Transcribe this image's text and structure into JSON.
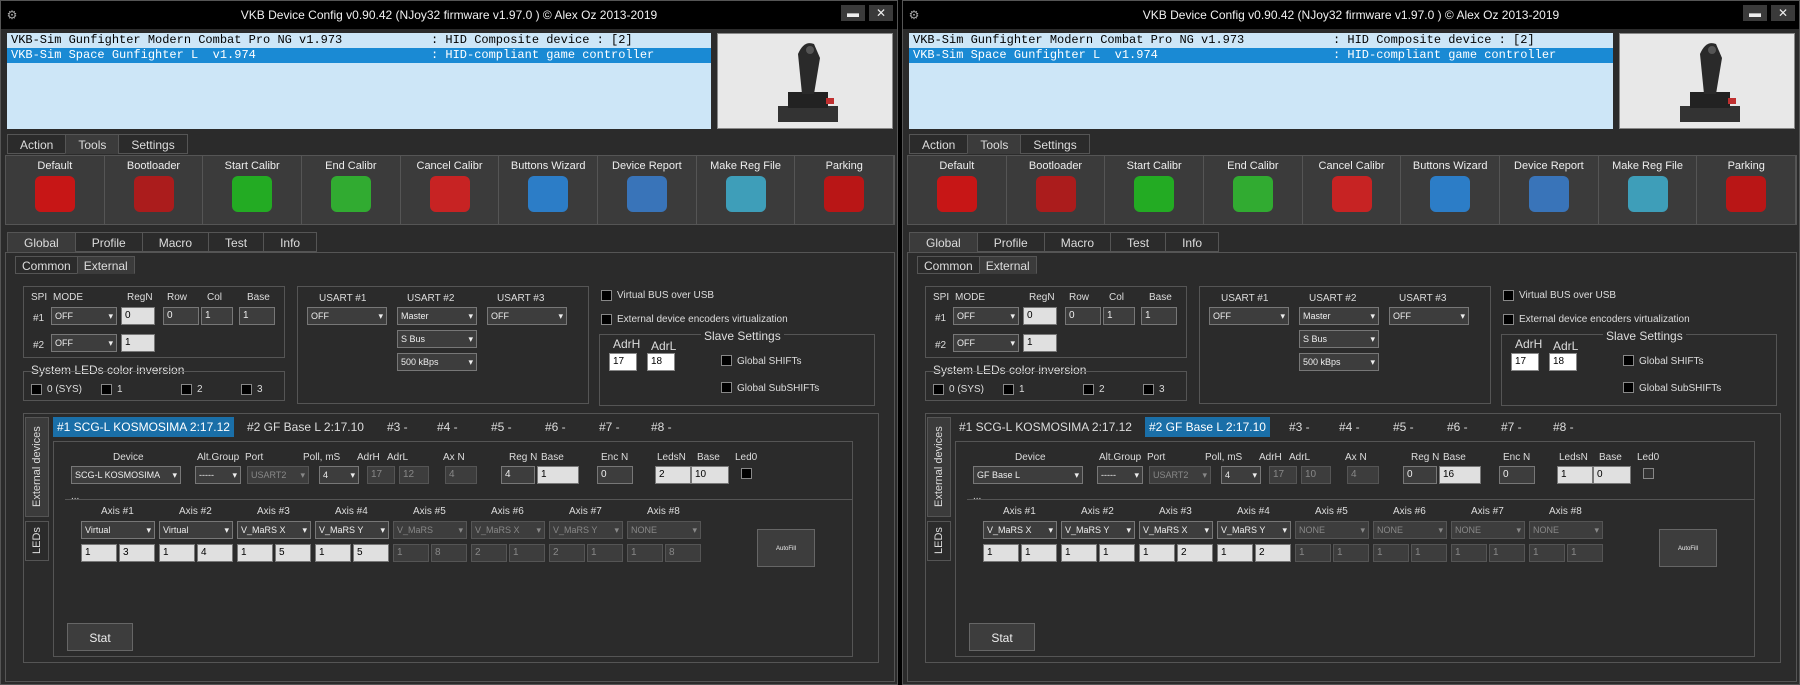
{
  "title": "VKB Device Config v0.90.42 (NJoy32 firmware v1.97.0  ) © Alex Oz 2013-2019",
  "window_buttons": {
    "minimize": "▬",
    "close": "✕"
  },
  "devices": [
    {
      "name": "VKB-Sim Gunfighter Modern Combat Pro NG v1.973",
      "desc": ": HID Composite device : [2]"
    },
    {
      "name": "VKB-Sim Space Gunfighter L  v1.974",
      "desc": ": HID-compliant game controller"
    }
  ],
  "main_tabs": [
    "Action",
    "Tools",
    "Settings"
  ],
  "tools": [
    {
      "label": "Default",
      "icon": "red-button-icon",
      "color": "#e01010"
    },
    {
      "label": "Bootloader",
      "icon": "recycle-icon",
      "color": "#c01818"
    },
    {
      "label": "Start Calibr",
      "icon": "caliper-play-icon",
      "color": "#20c020"
    },
    {
      "label": "End Calibr",
      "icon": "caliper-check-icon",
      "color": "#30c030"
    },
    {
      "label": "Cancel Calibr",
      "icon": "caliper-cross-icon",
      "color": "#e02020"
    },
    {
      "label": "Buttons Wizard",
      "icon": "wizard-icon",
      "color": "#2a8ae0"
    },
    {
      "label": "Device Report",
      "icon": "report-icon",
      "color": "#3a7fd0"
    },
    {
      "label": "Make Reg File",
      "icon": "cube-icon",
      "color": "#40b0d0"
    },
    {
      "label": "Parking",
      "icon": "parking-icon",
      "color": "#d01010"
    }
  ],
  "sub_tabs": [
    "Global",
    "Profile",
    "Macro",
    "Test",
    "Info"
  ],
  "inner_tabs": [
    "Common",
    "External"
  ],
  "spi": {
    "headers": [
      "SPI",
      "MODE",
      "RegN",
      "Row",
      "Col",
      "Base"
    ],
    "rows": [
      {
        "label": "#1",
        "mode": "OFF",
        "regn": "0",
        "row": "0",
        "col": "1",
        "base": "1"
      },
      {
        "label": "#2",
        "mode": "OFF",
        "regn": "1"
      }
    ]
  },
  "sys_leds": {
    "title": "System LEDs color inversion",
    "items": [
      "0 (SYS)",
      "1",
      "2",
      "3"
    ]
  },
  "usart": {
    "headers": [
      "USART #1",
      "USART #2",
      "USART #3"
    ],
    "u1": "OFF",
    "u2": "Master",
    "u2b": "S Bus",
    "u2c": "500 kBps",
    "u3": "OFF"
  },
  "virt": {
    "bus": "Virtual BUS over USB",
    "enc": "External device encoders virtualization"
  },
  "slave": {
    "title": "Slave Settings",
    "adrh_label": "AdrH",
    "adrl_label": "AdrL",
    "adrh": "17",
    "adrl": "18",
    "gshift": "Global SHIFTs",
    "gsubshift": "Global SubSHIFTs"
  },
  "ext_tabs": [
    "#1 SCG-L KOSMOSIMA 2:17.12",
    "#2 GF Base L 2:17.10",
    "#3 -",
    "#4 -",
    "#5 -",
    "#6 -",
    "#7 -",
    "#8 -"
  ],
  "side_tabs": [
    "External devices",
    "LEDs"
  ],
  "dev_headers": [
    "Device",
    "Alt.Group",
    "Port",
    "Poll, mS",
    "AdrH",
    "AdrL",
    "Ax N",
    "Reg N",
    "Base",
    "Enc N",
    "LedsN",
    "Base",
    "Led0"
  ],
  "ellipsis": "...",
  "axis_headers": [
    "Axis #1",
    "Axis #2",
    "Axis #3",
    "Axis #4",
    "Axis #5",
    "Axis #6",
    "Axis #7",
    "Axis #8"
  ],
  "autofill": "AutoFill",
  "stat": "Stat",
  "windows": [
    {
      "sel_device": 1,
      "ext_active": 0,
      "dev": {
        "device": "SCG-L KOSMOSIMA",
        "alt": "-----",
        "port": "USART2",
        "poll": "4",
        "adrh": "17",
        "adrl": "12",
        "axn": "4",
        "regn": "4",
        "base": "1",
        "encn": "0",
        "ledsn": "2",
        "base2": "10"
      },
      "axes": [
        {
          "sel": "Virtual",
          "a": "1",
          "b": "3"
        },
        {
          "sel": "Virtual",
          "a": "1",
          "b": "4"
        },
        {
          "sel": "V_MaRS X",
          "a": "1",
          "b": "5"
        },
        {
          "sel": "V_MaRS Y",
          "a": "1",
          "b": "5"
        },
        {
          "sel": "V_MaRS",
          "a": "1",
          "b": "8"
        },
        {
          "sel": "V_MaRS X",
          "a": "2",
          "b": "1"
        },
        {
          "sel": "V_MaRS Y",
          "a": "2",
          "b": "1"
        },
        {
          "sel": "NONE",
          "a": "1",
          "b": "8"
        }
      ]
    },
    {
      "sel_device": 1,
      "ext_active": 1,
      "dev": {
        "device": "GF Base L",
        "alt": "-----",
        "port": "USART2",
        "poll": "4",
        "adrh": "17",
        "adrl": "10",
        "axn": "4",
        "regn": "0",
        "base": "16",
        "encn": "0",
        "ledsn": "1",
        "base2": "0"
      },
      "axes": [
        {
          "sel": "V_MaRS X",
          "a": "1",
          "b": "1"
        },
        {
          "sel": "V_MaRS Y",
          "a": "1",
          "b": "1"
        },
        {
          "sel": "V_MaRS X",
          "a": "1",
          "b": "2"
        },
        {
          "sel": "V_MaRS Y",
          "a": "1",
          "b": "2"
        },
        {
          "sel": "NONE",
          "a": "1",
          "b": "1"
        },
        {
          "sel": "NONE",
          "a": "1",
          "b": "1"
        },
        {
          "sel": "NONE",
          "a": "1",
          "b": "1"
        },
        {
          "sel": "NONE",
          "a": "1",
          "b": "1"
        }
      ]
    }
  ]
}
